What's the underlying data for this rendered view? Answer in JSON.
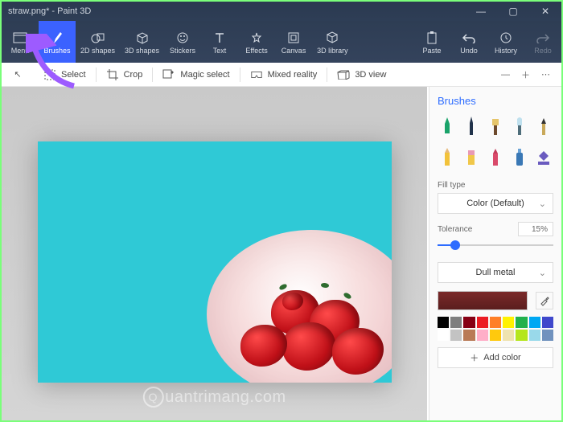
{
  "window": {
    "title": "straw.png* - Paint 3D",
    "min": "—",
    "max": "▢",
    "close": "✕"
  },
  "ribbon": {
    "menu": "Menu",
    "brushes": "Brushes",
    "shapes2d": "2D shapes",
    "shapes3d": "3D shapes",
    "stickers": "Stickers",
    "text": "Text",
    "effects": "Effects",
    "canvas": "Canvas",
    "library3d": "3D library",
    "paste": "Paste",
    "undo": "Undo",
    "history": "History",
    "redo": "Redo"
  },
  "subbar": {
    "select": "Select",
    "crop": "Crop",
    "magic": "Magic select",
    "mixed": "Mixed reality",
    "view3d": "3D view"
  },
  "panel": {
    "title": "Brushes",
    "fill_label": "Fill type",
    "fill_value": "Color (Default)",
    "tol_label": "Tolerance",
    "tol_value": "15%",
    "material_value": "Dull metal",
    "add_color": "Add color"
  },
  "palette": {
    "row1": [
      "#000000",
      "#7f7f7f",
      "#870014",
      "#ec1c24",
      "#ff7f27",
      "#fff200",
      "#21b14c",
      "#00a8f3",
      "#3f48cc"
    ],
    "row2": [
      "#ffffff",
      "#c3c3c3",
      "#b97a56",
      "#ffaec8",
      "#ffc90d",
      "#efe3af",
      "#b5e61d",
      "#99d9ea",
      "#7092be"
    ]
  },
  "watermark": "uantrimang.com"
}
